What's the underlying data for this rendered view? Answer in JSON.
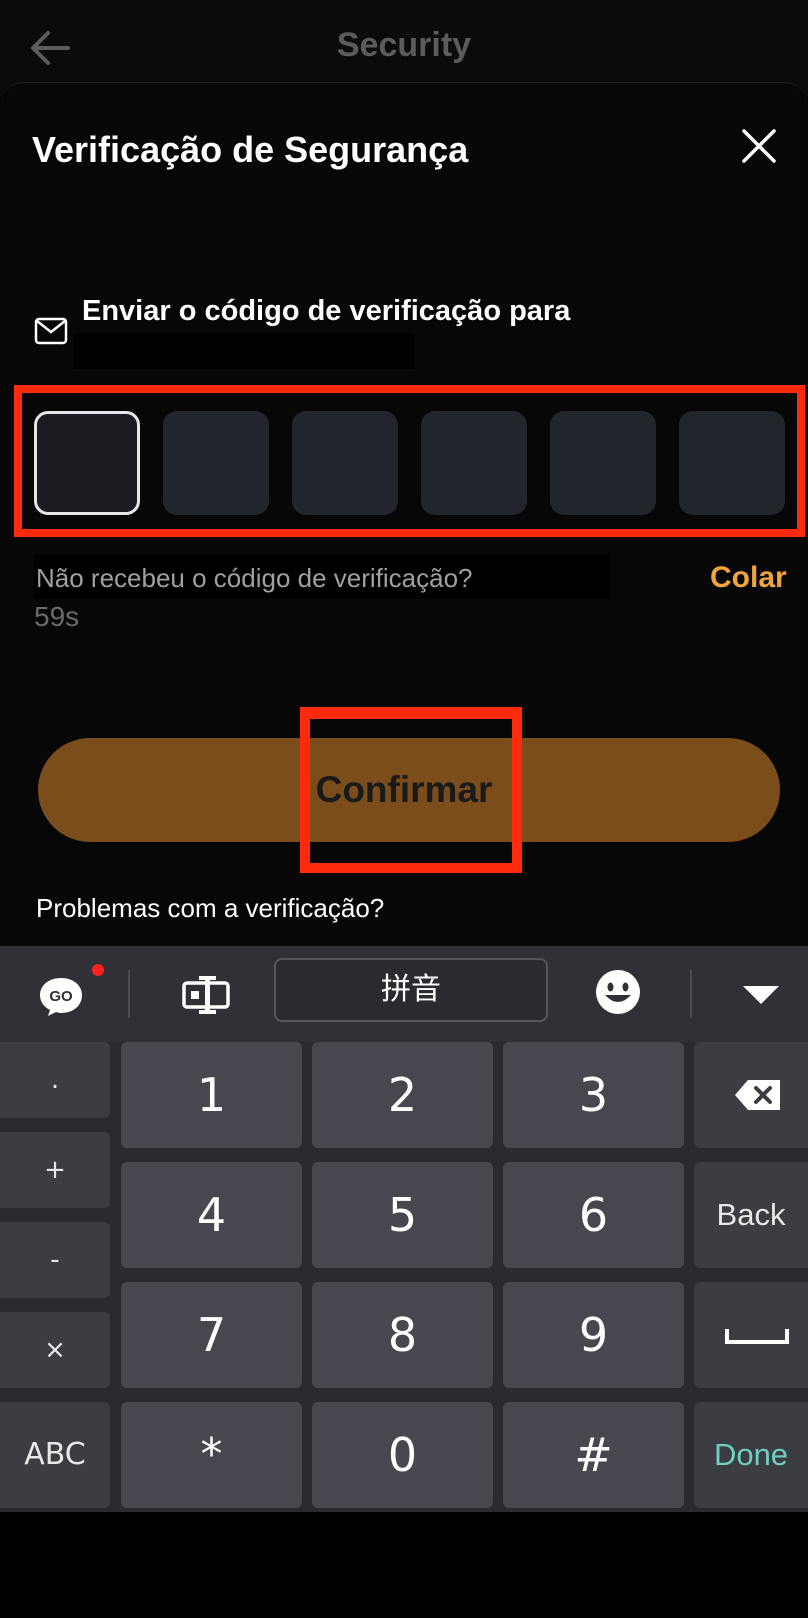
{
  "topbar": {
    "title": "Security"
  },
  "sheet": {
    "title": "Verificação de Segurança",
    "send_label": "Enviar o código de verificação para",
    "code_boxes": [
      "",
      "",
      "",
      "",
      "",
      ""
    ],
    "hint": "Não recebeu o código de verificação?",
    "paste_label": "Colar",
    "timer": "59s",
    "confirm_label": "Confirmar",
    "problems_label": "Problemas com a verificação?"
  },
  "keyboard": {
    "toolbar": {
      "go_label": "GO",
      "pinyin_label": "拼音"
    },
    "side_keys": [
      ".",
      "+",
      "-",
      "×",
      "ABC"
    ],
    "digits": [
      "1",
      "2",
      "3",
      "4",
      "5",
      "6",
      "7",
      "8",
      "9",
      "*",
      "0",
      "#"
    ],
    "back_label": "Back",
    "done_label": "Done"
  },
  "colors": {
    "accent": "#f0a53a",
    "confirm_bg": "#7a4d1b",
    "highlight": "#ff2a0c",
    "done_text": "#6fd0c0"
  },
  "icons": {
    "back": "arrow-left-icon",
    "close": "close-icon",
    "mail": "mail-icon",
    "go": "go-keyboard-icon",
    "cursor": "cursor-move-icon",
    "emoji": "emoji-icon",
    "hide": "hide-keyboard-icon",
    "backspace": "backspace-icon",
    "space": "space-icon"
  }
}
